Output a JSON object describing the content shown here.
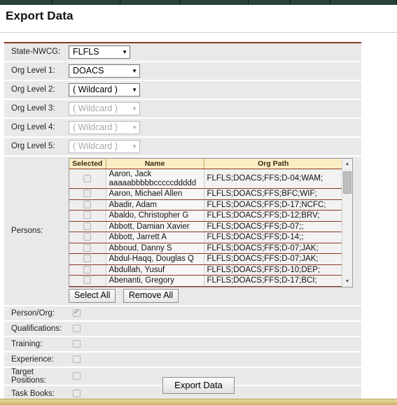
{
  "topnav": {
    "segments": [
      75,
      97,
      86,
      97,
      60,
      57,
      95
    ]
  },
  "header": {
    "title": "Export Data"
  },
  "form": {
    "fields": [
      {
        "label": "State-NWCG:",
        "value": "FLFLS",
        "width": "w-sm",
        "disabled": false
      },
      {
        "label": "Org Level 1:",
        "value": "DOACS",
        "width": "w-md",
        "disabled": false
      },
      {
        "label": "Org Level 2:",
        "value": "( Wildcard )",
        "width": "w-md",
        "disabled": false
      },
      {
        "label": "Org Level 3:",
        "value": "( Wildcard )",
        "width": "w-md",
        "disabled": true
      },
      {
        "label": "Org Level 4:",
        "value": "( Wildcard )",
        "width": "w-md",
        "disabled": true
      },
      {
        "label": "Org Level 5:",
        "value": "( Wildcard )",
        "width": "w-md",
        "disabled": true
      }
    ],
    "dropdown_arrow": "▼"
  },
  "persons": {
    "label": "Persons:",
    "columns": [
      "Selected",
      "Name",
      "Org Path"
    ],
    "rows": [
      {
        "selected": false,
        "name": "Aaron, Jack aaaaabbbbbcccccddddd",
        "org_path": "FLFLS;DOACS;FFS;D-04;WAM;"
      },
      {
        "selected": false,
        "name": "Aaron, Michael Allen",
        "org_path": "FLFLS;DOACS;FFS;BFC;WIF;"
      },
      {
        "selected": false,
        "name": "Abadir, Adam",
        "org_path": "FLFLS;DOACS;FFS;D-17;NCFC;"
      },
      {
        "selected": false,
        "name": "Abaldo, Christopher G",
        "org_path": "FLFLS;DOACS;FFS;D-12;BRV;"
      },
      {
        "selected": false,
        "name": "Abbott, Damian Xavier",
        "org_path": "FLFLS;DOACS;FFS;D-07;;"
      },
      {
        "selected": false,
        "name": "Abbott, Jarrett A",
        "org_path": "FLFLS;DOACS;FFS;D-14;;"
      },
      {
        "selected": false,
        "name": "Abboud, Danny S",
        "org_path": "FLFLS;DOACS;FFS;D-07;JAK;"
      },
      {
        "selected": false,
        "name": "Abdul-Haqq, Douglas Q",
        "org_path": "FLFLS;DOACS;FFS;D-07;JAK;"
      },
      {
        "selected": false,
        "name": "Abdullah, Yusuf",
        "org_path": "FLFLS;DOACS;FFS;D-10;DEP;"
      },
      {
        "selected": false,
        "name": "Abenanti, Gregory",
        "org_path": "FLFLS;DOACS;FFS;D-17;BCI;"
      }
    ],
    "select_all_label": "Select All",
    "remove_all_label": "Remove All",
    "scroll_up_arrow": "▲",
    "scroll_down_arrow": "▼"
  },
  "options": [
    {
      "label": "Person/Org:",
      "checked": true
    },
    {
      "label": "Qualifications:",
      "checked": false
    },
    {
      "label": "Training:",
      "checked": false
    },
    {
      "label": "Experience:",
      "checked": false
    },
    {
      "label": "Target Positions:",
      "checked": false
    },
    {
      "label": "Task Books:",
      "checked": false
    }
  ],
  "actions": {
    "export_label": "Export Data"
  },
  "colors": {
    "nav_green": "#27423b",
    "accent_red": "#8a3a1e",
    "header_yellow": "#fbeec4",
    "row_grey": "#e9e9e9",
    "footer_gold": "#cdb262"
  }
}
